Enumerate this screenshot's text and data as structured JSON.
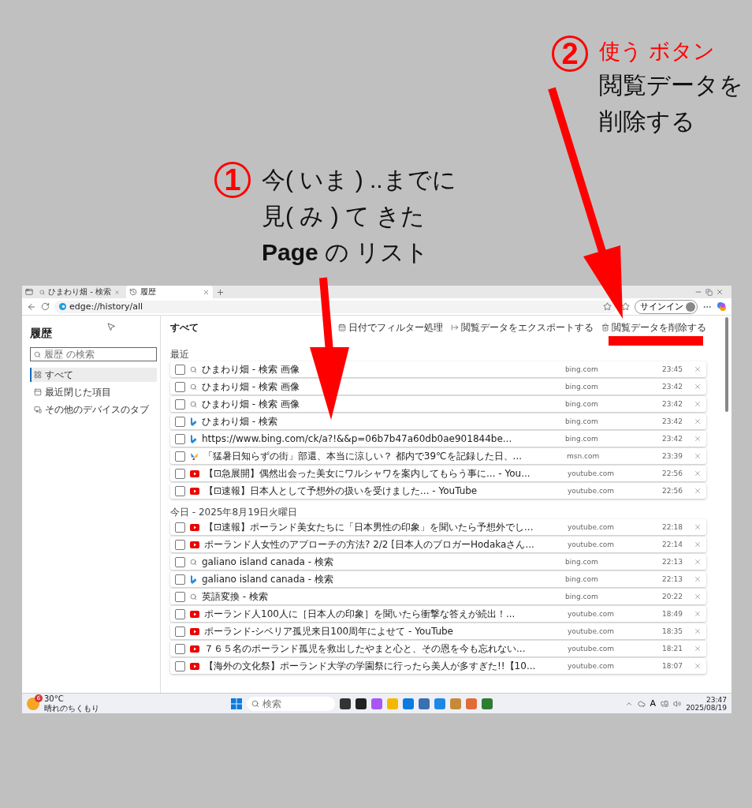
{
  "annotations": [
    {
      "number": "2",
      "lines": [
        {
          "kind": "heading",
          "text": "使う ボタン"
        },
        {
          "kind": "body",
          "text": "閲覧データを"
        },
        {
          "kind": "body",
          "text": "削除する"
        }
      ]
    },
    {
      "number": "1",
      "lines": [
        {
          "kind": "body",
          "text": "今( いま ) ..までに"
        },
        {
          "kind": "body",
          "text": "見( み ) て きた"
        },
        {
          "kind": "body",
          "text": "**Page** の リスト"
        }
      ]
    }
  ],
  "browser": {
    "tabs": [
      {
        "title": "ひまわり畑 - 検索",
        "kind": "search",
        "selected": false
      },
      {
        "title": "履歴",
        "kind": "history",
        "selected": true
      }
    ],
    "address": "edge://history/all",
    "signin": "サインイン",
    "sidebar": {
      "title": "履歴",
      "search_placeholder": "履歴 の検索",
      "items": [
        {
          "label": "すべて",
          "kind": "grid",
          "selected": true
        },
        {
          "label": "最近閉じた項目",
          "kind": "recent",
          "selected": false
        },
        {
          "label": "その他のデバイスのタブ",
          "kind": "devices",
          "selected": false
        }
      ]
    },
    "main": {
      "title": "すべて",
      "actions": [
        {
          "label": "日付でフィルター処理",
          "kind": "calendar"
        },
        {
          "label": "閲覧データをエクスポートする",
          "kind": "export"
        },
        {
          "label": "閲覧データを削除する",
          "kind": "trash",
          "highlighted": true
        }
      ],
      "sections": [
        {
          "heading": "最近",
          "rows": [
            {
              "kind": "search",
              "checked": false,
              "title": "ひまわり畑 - 検索 画像",
              "domain": "bing.com",
              "time": "23:45"
            },
            {
              "kind": "search",
              "checked": false,
              "title": "ひまわり畑 - 検索 画像",
              "domain": "bing.com",
              "time": "23:42"
            },
            {
              "kind": "search",
              "checked": false,
              "title": "ひまわり畑 - 検索 画像",
              "domain": "bing.com",
              "time": "23:42"
            },
            {
              "kind": "bing",
              "checked": false,
              "title": "ひまわり畑 - 検索",
              "domain": "bing.com",
              "time": "23:42"
            },
            {
              "kind": "bing",
              "checked": false,
              "title": "https://www.bing.com/ck/a?!&&p=06b7b47a60db0ae901844be...",
              "domain": "bing.com",
              "time": "23:42"
            },
            {
              "kind": "msn",
              "checked": false,
              "title": "「猛暑日知らずの街」部還、本当に涼しい？ 都内で39℃を記録した日、...",
              "domain": "msn.com",
              "time": "23:39"
            },
            {
              "kind": "youtube",
              "checked": false,
              "title": "【⊡急展開】偶然出会った美女にワルシャワを案内してもらう事に... - You...",
              "domain": "youtube.com",
              "time": "22:56"
            },
            {
              "kind": "youtube",
              "checked": false,
              "title": "【⊡速報】日本人として予想外の扱いを受けました... - YouTube",
              "domain": "youtube.com",
              "time": "22:56"
            }
          ]
        },
        {
          "heading": "今日 - 2025年8月19日火曜日",
          "rows": [
            {
              "kind": "youtube",
              "checked": false,
              "title": "【⊡速報】ポーランド美女たちに「日本男性の印象」を聞いたら予想外でし...",
              "domain": "youtube.com",
              "time": "22:18"
            },
            {
              "kind": "youtube",
              "checked": false,
              "title": "ポーランド人女性のアプローチの方法? 2/2 [日本人のブロガーHodakaさん...",
              "domain": "youtube.com",
              "time": "22:14"
            },
            {
              "kind": "search",
              "checked": false,
              "title": "galiano island canada - 検索",
              "domain": "bing.com",
              "time": "22:13"
            },
            {
              "kind": "bing",
              "checked": false,
              "title": "galiano island canada - 検索",
              "domain": "bing.com",
              "time": "22:13"
            },
            {
              "kind": "search",
              "checked": false,
              "title": "英語変換 - 検索",
              "domain": "bing.com",
              "time": "20:22"
            },
            {
              "kind": "youtube",
              "checked": false,
              "title": "ポーランド人100人に［日本人の印象］を聞いたら衝撃な答えが続出！...",
              "domain": "youtube.com",
              "time": "18:49"
            },
            {
              "kind": "youtube",
              "checked": false,
              "title": "ポーランド-シベリア孤児来日100周年によせて - YouTube",
              "domain": "youtube.com",
              "time": "18:35"
            },
            {
              "kind": "youtube",
              "checked": false,
              "title": "７６５名のポーランド孤児を救出したやまと心と、その恩を今も忘れない...",
              "domain": "youtube.com",
              "time": "18:21"
            },
            {
              "kind": "youtube",
              "checked": false,
              "title": "【海外の文化祭】ポーランド大学の学園祭に行ったら美人が多すぎた!!【10...",
              "domain": "youtube.com",
              "time": "18:07"
            }
          ]
        }
      ]
    }
  },
  "taskbar": {
    "badge": "6",
    "temperature": "30°C",
    "weather": "晴れのちくもり",
    "search_placeholder": "検索",
    "ime": "A",
    "time": "23:47",
    "date": "2025/08/19"
  }
}
